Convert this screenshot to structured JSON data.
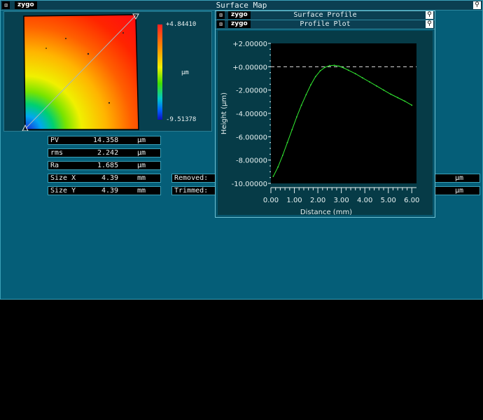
{
  "main_window": {
    "title": "Surface Map",
    "logo": "zygo"
  },
  "colorbar": {
    "max_label": "+4.84410",
    "min_label": "-9.51378",
    "unit": "µm"
  },
  "stats": [
    {
      "name": "PV",
      "value": "14.358",
      "unit": "µm"
    },
    {
      "name": "rms",
      "value": "2.242",
      "unit": "µm"
    },
    {
      "name": "Ra",
      "value": "1.685",
      "unit": "µm"
    },
    {
      "name": "Size X",
      "value": "4.39",
      "unit": "mm"
    },
    {
      "name": "Size Y",
      "value": "4.39",
      "unit": "mm"
    }
  ],
  "removed_label": "Removed:",
  "trimmed_label": "Trimmed:",
  "right_units": [
    "µm",
    "µm"
  ],
  "surface_profile_window": {
    "title": "Surface Profile",
    "logo": "zygo"
  },
  "profile_plot_window": {
    "title": "Profile Plot",
    "logo": "zygo"
  },
  "icons": {
    "system_menu": "close-box-icon",
    "pin": "pin-icon"
  },
  "colors": {
    "window_bg": "#055e78",
    "title_bg": "#0b3f52",
    "plot_bg": "#000000",
    "curve": "#33ee33"
  },
  "chart_data": {
    "type": "line",
    "xlabel": "Distance (mm)",
    "ylabel": "Height (µm)",
    "xlim": [
      0,
      6.2
    ],
    "ylim": [
      -10,
      2
    ],
    "x_tick_labels": [
      "0.00",
      "1.00",
      "2.00",
      "3.00",
      "4.00",
      "5.00",
      "6.00"
    ],
    "y_tick_labels": [
      "+2.00000",
      "+0.00000",
      "-2.00000",
      "-4.00000",
      "-6.00000",
      "-8.00000",
      "-10.00000"
    ],
    "reference_line_y": 0,
    "series": [
      {
        "x": [
          0.1,
          0.3,
          0.5,
          0.7,
          0.9,
          1.1,
          1.3,
          1.5,
          1.7,
          1.9,
          2.1,
          2.3,
          2.5,
          2.7,
          2.9,
          3.1,
          3.3,
          3.6,
          3.9,
          4.2,
          4.5,
          4.8,
          5.1,
          5.4,
          5.7,
          6.0
        ],
        "y": [
          -9.4,
          -8.6,
          -7.6,
          -6.5,
          -5.4,
          -4.3,
          -3.3,
          -2.4,
          -1.55,
          -0.85,
          -0.35,
          -0.05,
          0.1,
          0.12,
          0.05,
          -0.1,
          -0.3,
          -0.6,
          -0.95,
          -1.3,
          -1.65,
          -2.0,
          -2.35,
          -2.65,
          -2.95,
          -3.3
        ]
      }
    ]
  }
}
